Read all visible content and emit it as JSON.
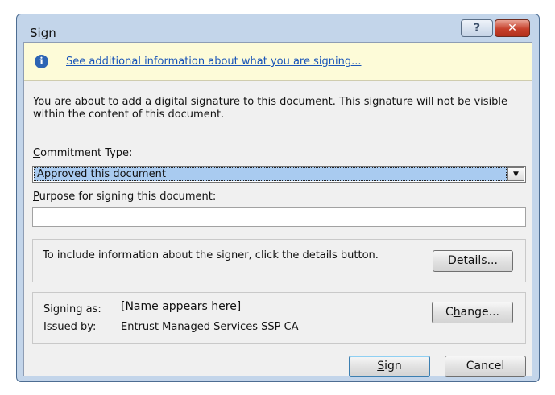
{
  "dialog": {
    "title": "Sign",
    "help_label": "?",
    "close_label": "✕"
  },
  "infobar": {
    "icon": "info-icon",
    "icon_glyph": "i",
    "link_text": "See additional information about what you are signing..."
  },
  "intro_text": "You are about to add a digital signature to this document. This signature will not be visible within the content of this document.",
  "commitment": {
    "label_first": "C",
    "label_rest": "ommitment Type:",
    "selected": "Approved this document",
    "arrow": "▼"
  },
  "purpose": {
    "label_first": "P",
    "label_rest": "urpose for signing this document:",
    "value": ""
  },
  "details": {
    "text": "To include information about the signer, click the details button.",
    "button_first": "D",
    "button_rest": "etails..."
  },
  "signing": {
    "signing_as_label": "Signing as:",
    "signing_as_value": "[Name appears here]",
    "issued_by_label": "Issued by:",
    "issued_by_value": "Entrust Managed Services SSP CA",
    "change_pre": "C",
    "change_u": "h",
    "change_post": "ange..."
  },
  "actions": {
    "sign_u": "S",
    "sign_rest": "ign",
    "cancel": "Cancel"
  }
}
